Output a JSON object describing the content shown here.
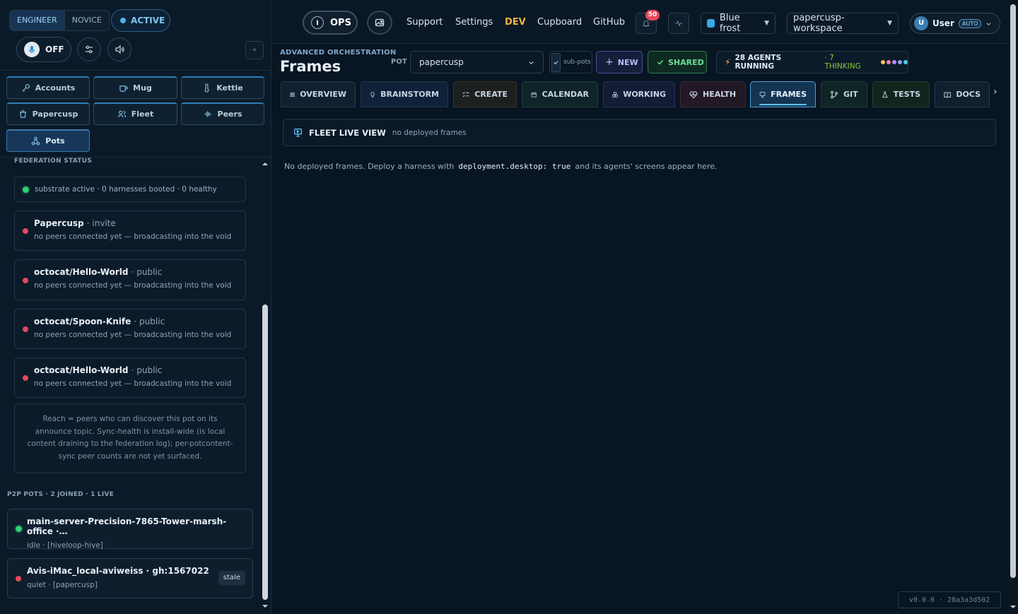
{
  "sidebar": {
    "mode_engineer": "ENGINEER",
    "mode_novice": "NOVICE",
    "active_label": "ACTIVE",
    "power_label": "OFF",
    "collapse_label": "«",
    "nav": {
      "accounts": "Accounts",
      "mug": "Mug",
      "kettle": "Kettle",
      "papercusp": "Papercusp",
      "fleet": "Fleet",
      "peers": "Peers",
      "pots": "Pots"
    },
    "federation_label": "FEDERATION STATUS",
    "substrate_status": "substrate active · 0 harnesses booted · 0 healthy",
    "pots": [
      {
        "name": "Papercusp",
        "visibility": "· invite",
        "status": "no peers connected yet — broadcasting into the void"
      },
      {
        "name": "octocat/Hello-World",
        "visibility": "· public",
        "status": "no peers connected yet — broadcasting into the void"
      },
      {
        "name": "octocat/Spoon-Knife",
        "visibility": "· public",
        "status": "no peers connected yet — broadcasting into the void"
      },
      {
        "name": "octocat/Hello-World",
        "visibility": "· public",
        "status": "no peers connected yet — broadcasting into the void"
      }
    ],
    "reach_note": "Reach = peers who can discover this pot on its announce topic. Sync-health is install-wide (is local content draining to the federation log); per-potcontent-sync peer counts are not yet surfaced.",
    "p2p_label": "P2P POTS · 2 JOINED · 1 LIVE",
    "p2p": [
      {
        "name": "main-server-Precision-7865-Tower-marsh-office ·…",
        "status": "idle · [hiveloop-hive]"
      },
      {
        "name": "Avis-iMac_local-aviweiss · gh:1567022",
        "status": "quiet · [papercusp]",
        "tag": "stale"
      }
    ]
  },
  "topbar": {
    "ops_label": "OPS",
    "links": {
      "support": "Support",
      "settings": "Settings",
      "dev": "DEV",
      "cupboard": "Cupboard",
      "github": "GitHub"
    },
    "notification_count": "50",
    "theme_select": "Blue frost",
    "workspace_select": "papercusp-workspace",
    "user_initial": "U",
    "user_label": "User",
    "auto_badge": "AUTO"
  },
  "header": {
    "subtitle": "ADVANCED ORCHESTRATION",
    "title": "Frames",
    "pot_label": "POT",
    "pot_value": "papercusp",
    "subpots_label": "sub-pots",
    "new_label": "NEW",
    "shared_label": "SHARED",
    "agents_running": "28 AGENTS RUNNING",
    "agents_thinking": "· 7 THINKING"
  },
  "tabs": {
    "overview": "OVERVIEW",
    "brainstorm": "BRAINSTORM",
    "create": "CREATE",
    "calendar": "CALENDAR",
    "working": "WORKING",
    "health": "HEALTH",
    "frames": "FRAMES",
    "git": "GIT",
    "tests": "TESTS",
    "docs": "DOCS"
  },
  "main": {
    "fleet_title": "FLEET LIVE VIEW",
    "fleet_sub": "no deployed frames",
    "empty_prefix": "No deployed frames. Deploy a harness with",
    "empty_code": "deployment.desktop: true",
    "empty_suffix": "and its agents' screens appear here.",
    "version": "v0.0.0 · 28a3a3d502"
  },
  "colors": {
    "accent": "#5cc3f7",
    "ok": "#2fd07a",
    "error": "#e5485f",
    "dev": "#f2b33d",
    "thinking": "#8cc63f"
  }
}
